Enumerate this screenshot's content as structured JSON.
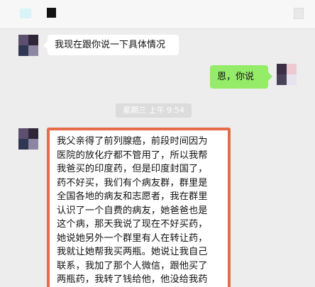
{
  "chat": {
    "message_1": "我现在跟你说一下具体情况",
    "message_2": "恩，你说",
    "timestamp": "星期三 上午 9:54",
    "message_3": {
      "lines": [
        "我父亲得了前列腺癌，前段时间因为",
        "医院的放化疗都不管用了，所以我帮",
        "我爸买的印度药，但是印度封国了，",
        "药不好买，我们有个病友群，群里是",
        "全国各地的病友和志愿者，我在群里",
        "认识了一个自费的病友，她爸爸也是",
        "这个病，那天我说了现在不好买药，",
        "她说她另外一个群里有人在转让药，",
        "我就让她帮我买两瓶。她说让我自己",
        "联系，我加了那个人微信，跟他买了",
        "两瓶药，我转了钱给他，他没给我药"
      ]
    }
  },
  "colors": {
    "background": "#ededed",
    "incoming_bubble": "#ffffff",
    "outgoing_bubble": "#95ec69",
    "highlight_border": "#e46c49"
  }
}
